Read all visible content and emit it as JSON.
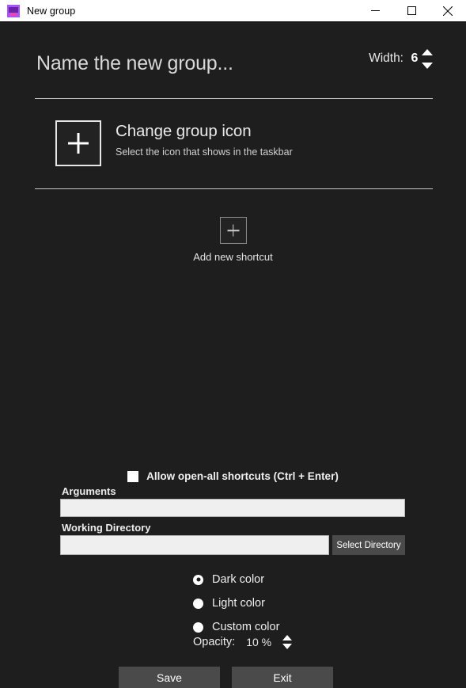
{
  "window": {
    "title": "New group",
    "icon": "app-icon",
    "controls": {
      "minimize": "minimize-icon",
      "maximize": "maximize-icon",
      "close": "close-icon"
    }
  },
  "header": {
    "name_value": "",
    "name_placeholder": "Name the new group...",
    "width_label": "Width:",
    "width_value": "6",
    "spinner_up": "spinner-up-icon",
    "spinner_down": "spinner-down-icon"
  },
  "group_icon": {
    "plus": "plus-icon",
    "title": "Change group icon",
    "subtitle": "Select the icon that shows in the taskbar"
  },
  "shortcuts": {
    "add_plus": "plus-icon",
    "add_label": "Add new shortcut"
  },
  "options": {
    "allow_open_all_label": "Allow open-all shortcuts (Ctrl + Enter)",
    "allow_open_all_checked": false,
    "arguments_label": "Arguments",
    "arguments_value": "",
    "working_directory_label": "Working Directory",
    "working_directory_value": "",
    "select_directory_label": "Select Directory"
  },
  "color_modes": {
    "options": [
      {
        "label": "Dark color",
        "selected": true
      },
      {
        "label": "Light color",
        "selected": false
      },
      {
        "label": "Custom color",
        "selected": false
      }
    ],
    "opacity_label": "Opacity:",
    "opacity_value": "10 %"
  },
  "footer": {
    "save_label": "Save",
    "exit_label": "Exit"
  },
  "colors": {
    "background": "#1e1e1e",
    "titlebar": "#ffffff",
    "button": "#4a4a4a",
    "input": "#efefef",
    "accent_icon": "#a855f7",
    "accent_icon_dark": "#6b21a8",
    "accent_icon_pink": "#ff3ea5",
    "divider": "#c9c9c9"
  }
}
